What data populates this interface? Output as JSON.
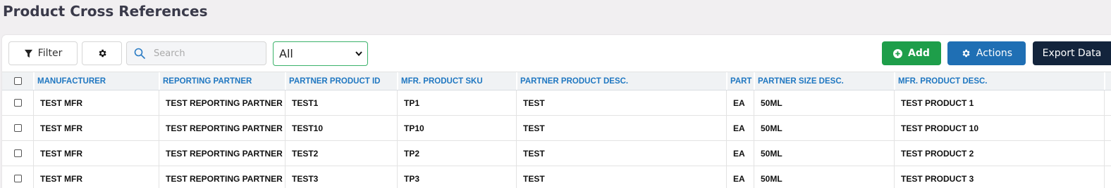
{
  "page": {
    "title": "Product Cross References"
  },
  "toolbar": {
    "filter_label": "Filter",
    "search_placeholder": "Search",
    "select_value": "All",
    "add_label": "Add",
    "actions_label": "Actions",
    "export_label": "Export Data"
  },
  "colors": {
    "accent_green": "#1e9e4a",
    "accent_blue": "#1f6fb4",
    "export_dark": "#13243c",
    "header_text": "#1f77c1"
  },
  "table": {
    "columns": [
      "MANUFACTURER",
      "REPORTING PARTNER",
      "PARTNER PRODUCT ID",
      "MFR. PRODUCT SKU",
      "PARTNER PRODUCT DESC.",
      "PART",
      "PARTNER SIZE DESC.",
      "MFR. PRODUCT DESC."
    ],
    "rows": [
      [
        "TEST MFR",
        "TEST REPORTING PARTNER",
        "TEST1",
        "TP1",
        "TEST",
        "EA",
        "50ML",
        "TEST PRODUCT 1"
      ],
      [
        "TEST MFR",
        "TEST REPORTING PARTNER",
        "TEST10",
        "TP10",
        "TEST",
        "EA",
        "50ML",
        "TEST PRODUCT 10"
      ],
      [
        "TEST MFR",
        "TEST REPORTING PARTNER",
        "TEST2",
        "TP2",
        "TEST",
        "EA",
        "50ML",
        "TEST PRODUCT 2"
      ],
      [
        "TEST MFR",
        "TEST REPORTING PARTNER",
        "TEST3",
        "TP3",
        "TEST",
        "EA",
        "50ML",
        "TEST PRODUCT 3"
      ]
    ]
  }
}
